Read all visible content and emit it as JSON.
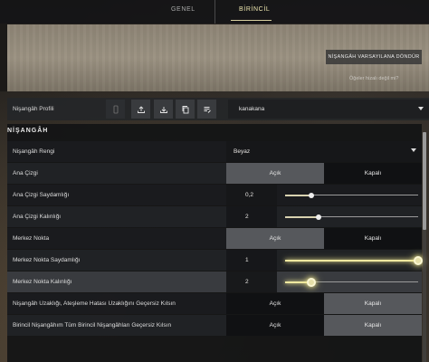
{
  "tabs": [
    {
      "label": "GENEL"
    },
    {
      "label": "BİRİNCİL"
    }
  ],
  "preview": {
    "reset_label": "NİŞANGÂH VARSAYILANA DÖNDÜR",
    "note": "Öğeler hizalı değil mi?"
  },
  "profile": {
    "label": "Nişangâh Profili",
    "selected": "kanakana",
    "icons": [
      "mobile-icon",
      "upload-icon",
      "download-icon",
      "copy-icon",
      "edit-list-icon"
    ]
  },
  "section": {
    "title": "NİŞANGÂH"
  },
  "rows": {
    "color": {
      "label": "Nişangâh Rengi",
      "value": "Beyaz"
    },
    "outline": {
      "label": "Ana Çizgi",
      "on": "Açık",
      "off": "Kapalı",
      "selected": "on"
    },
    "outline_opacity": {
      "label": "Ana Çizgi Saydamlığı",
      "value": "0,2",
      "fraction": 0.2
    },
    "outline_thickness": {
      "label": "Ana Çizgi Kalınlığı",
      "value": "2",
      "fraction": 0.25
    },
    "center_dot": {
      "label": "Merkez Nokta",
      "on": "Açık",
      "off": "Kapalı",
      "selected": "on"
    },
    "center_dot_opacity": {
      "label": "Merkez Nokta Saydamlığı",
      "value": "1",
      "fraction": 1.0
    },
    "center_dot_thickness": {
      "label": "Merkez Nokta Kalınlığı",
      "value": "2",
      "fraction": 0.2
    },
    "firing_error": {
      "label": "Nişangâh Uzaklığı, Ateşleme Hatası Uzaklığını Geçersiz Kılsın",
      "on": "Açık",
      "off": "Kapalı",
      "selected": "off"
    },
    "override_all": {
      "label": "Birincil Nişangâhım Tüm Birincil Nişangâhları Geçersiz Kılsın",
      "on": "Açık",
      "off": "Kapalı",
      "selected": "off"
    }
  },
  "colors": {
    "accent": "#efe8a0",
    "active_tab": "#f0e8b0"
  }
}
